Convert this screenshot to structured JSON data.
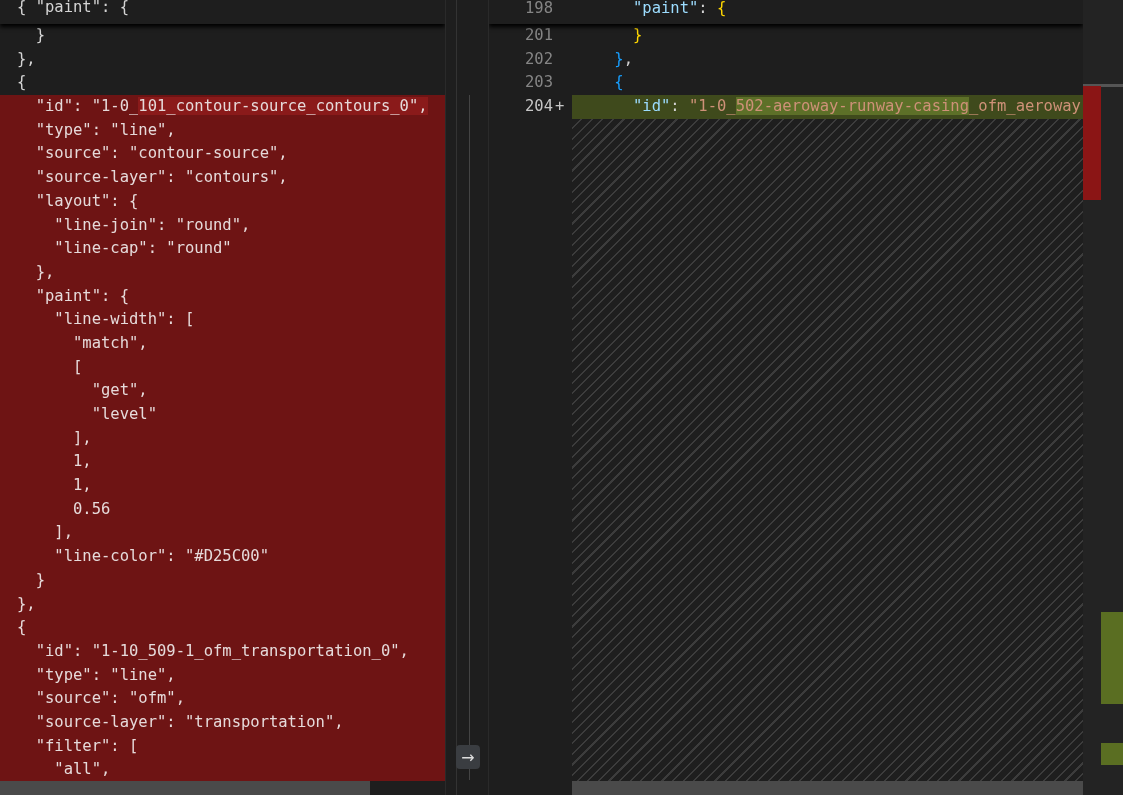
{
  "left_pane": {
    "sticky": "{ \"paint\": {",
    "lines": [
      {
        "kind": "normal",
        "text": "  }"
      },
      {
        "kind": "normal",
        "text": "},"
      },
      {
        "kind": "normal",
        "text": "{"
      },
      {
        "kind": "removed",
        "parts": [
          {
            "text": "  \"id\": \"1-0_",
            "changed": false
          },
          {
            "text": "101_contour-source_contours_0\",",
            "changed": true
          }
        ]
      },
      {
        "kind": "removed",
        "text": "  \"type\": \"line\","
      },
      {
        "kind": "removed",
        "text": "  \"source\": \"contour-source\","
      },
      {
        "kind": "removed",
        "text": "  \"source-layer\": \"contours\","
      },
      {
        "kind": "removed",
        "text": "  \"layout\": {"
      },
      {
        "kind": "removed",
        "text": "    \"line-join\": \"round\","
      },
      {
        "kind": "removed",
        "text": "    \"line-cap\": \"round\""
      },
      {
        "kind": "removed",
        "text": "  },"
      },
      {
        "kind": "removed",
        "text": "  \"paint\": {"
      },
      {
        "kind": "removed",
        "text": "    \"line-width\": ["
      },
      {
        "kind": "removed",
        "text": "      \"match\","
      },
      {
        "kind": "removed",
        "text": "      ["
      },
      {
        "kind": "removed",
        "text": "        \"get\","
      },
      {
        "kind": "removed",
        "text": "        \"level\""
      },
      {
        "kind": "removed",
        "text": "      ],"
      },
      {
        "kind": "removed",
        "text": "      1,"
      },
      {
        "kind": "removed",
        "text": "      1,"
      },
      {
        "kind": "removed",
        "text": "      0.56"
      },
      {
        "kind": "removed",
        "text": "    ],"
      },
      {
        "kind": "removed",
        "text": "    \"line-color\": \"#D25C00\""
      },
      {
        "kind": "removed",
        "text": "  }"
      },
      {
        "kind": "removed",
        "text": "},"
      },
      {
        "kind": "removed",
        "text": "{"
      },
      {
        "kind": "removed",
        "text": "  \"id\": \"1-10_509-1_ofm_transportation_0\","
      },
      {
        "kind": "removed",
        "text": "  \"type\": \"line\","
      },
      {
        "kind": "removed",
        "text": "  \"source\": \"ofm\","
      },
      {
        "kind": "removed",
        "text": "  \"source-layer\": \"transportation\","
      },
      {
        "kind": "removed",
        "text": "  \"filter\": ["
      },
      {
        "kind": "removed",
        "text": "    \"all\","
      }
    ]
  },
  "right_pane": {
    "sticky": {
      "number": "198",
      "text": "      \"paint\": {"
    },
    "lines": [
      {
        "number": "201",
        "kind": "normal",
        "text": "      }"
      },
      {
        "number": "202",
        "kind": "normal",
        "text": "    },"
      },
      {
        "number": "203",
        "kind": "normal",
        "text": "    {"
      },
      {
        "number": "204",
        "kind": "added",
        "marker": "+",
        "parts": [
          {
            "text": "      \"id\": \"1-0_",
            "changed": false
          },
          {
            "text": "502-aeroway-runway-casing",
            "changed": true
          },
          {
            "text": "_ofm_aeroway",
            "changed": false
          }
        ]
      }
    ]
  },
  "inline_diff_button": {
    "glyph": "→"
  }
}
